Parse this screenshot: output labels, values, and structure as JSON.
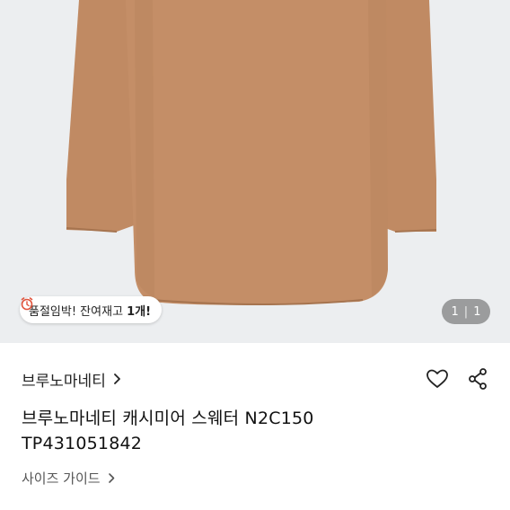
{
  "product_image": {
    "description_icon": "sweater-photo",
    "colors": {
      "sweater": "#c48e67",
      "sweater_shadow": "#b47f5a",
      "background": "#eceef0"
    }
  },
  "stock_badge": {
    "icon": "alarm-clock-icon",
    "text_prefix": "품절임박! 잔여재고 ",
    "count_text": "1개!"
  },
  "gallery": {
    "current": "1",
    "separator": "|",
    "total": "1"
  },
  "brand": {
    "name": "브루노마네티",
    "chevron_icon": "chevron-right-icon"
  },
  "actions": {
    "like_icon": "heart-icon",
    "share_icon": "share-icon"
  },
  "product": {
    "title_line1": "브루노마네티 캐시미어 스웨터 N2C150",
    "title_line2": "TP431051842"
  },
  "size_guide": {
    "label": "사이즈 가이드",
    "chevron_icon": "chevron-right-icon"
  }
}
